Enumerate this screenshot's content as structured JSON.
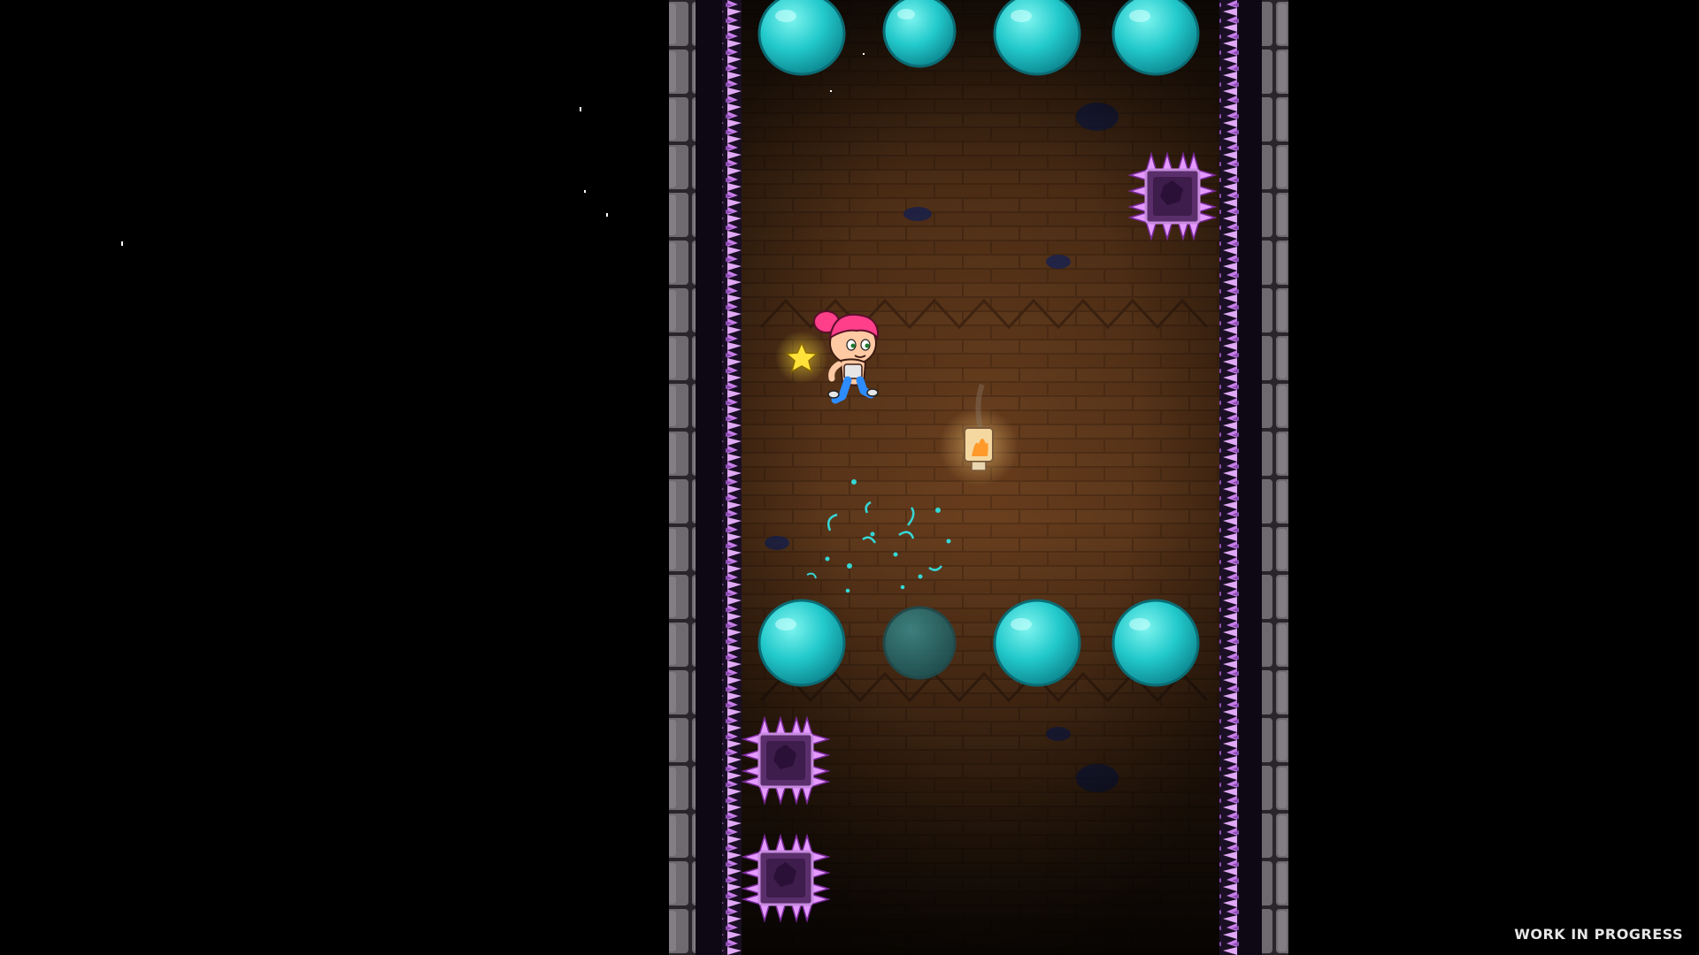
{
  "watermark": {
    "text": "WORK IN PROGRESS"
  },
  "colors": {
    "background": "#000000",
    "brick": "#6a3f1e",
    "brick_dark": "#3a2210",
    "stone_wall": "#6f6a70",
    "crystal_spikes": "#c97be6",
    "bubble": "#1fd3d6",
    "spike_block": "#5a2e6b",
    "hero_hair": "#ff3f8a",
    "hero_pants": "#2d8cff",
    "star": "#ffe23a",
    "lamp_flame": "#ffb347"
  },
  "scene": {
    "top_bubbles": [
      {
        "state": "intact"
      },
      {
        "state": "intact"
      },
      {
        "state": "intact"
      },
      {
        "state": "intact"
      }
    ],
    "bottom_bubbles": [
      {
        "state": "intact"
      },
      {
        "state": "faded"
      },
      {
        "state": "intact"
      },
      {
        "state": "intact"
      }
    ],
    "spike_blocks": [
      {
        "wall": "right"
      },
      {
        "wall": "left"
      },
      {
        "wall": "left"
      }
    ]
  }
}
